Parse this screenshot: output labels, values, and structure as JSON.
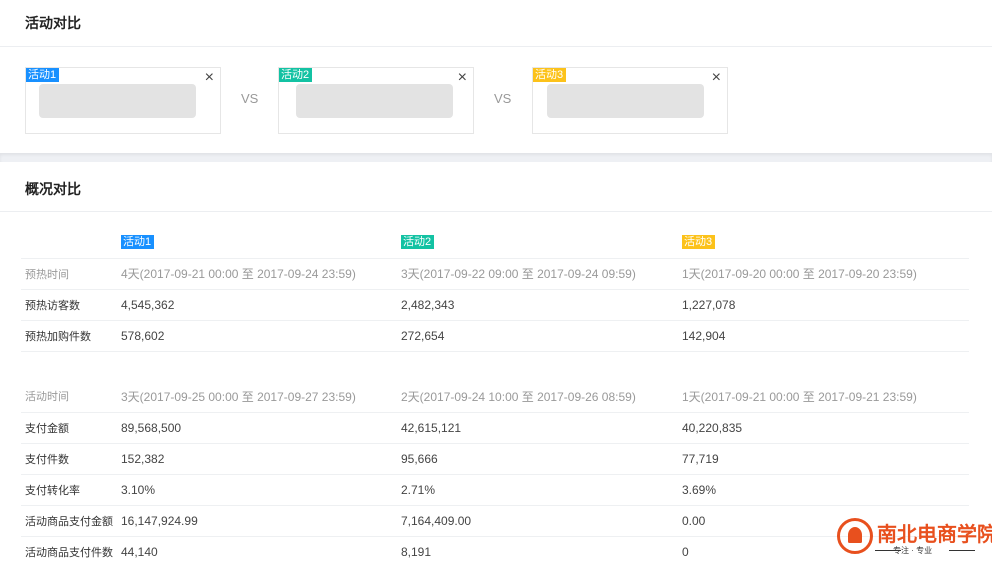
{
  "compare_section": {
    "title": "活动对比",
    "vs_label": "VS",
    "cards": [
      {
        "tag": "活动1",
        "close": "×"
      },
      {
        "tag": "活动2",
        "close": "×"
      },
      {
        "tag": "活动3",
        "close": "×"
      }
    ]
  },
  "overview_section": {
    "title": "概况对比",
    "columns": [
      "活动1",
      "活动2",
      "活动3"
    ],
    "rows": [
      {
        "label": "预热时间",
        "values": [
          "4天(2017-09-21 00:00 至 2017-09-24 23:59)",
          "3天(2017-09-22 09:00 至 2017-09-24 09:59)",
          "1天(2017-09-20 00:00 至 2017-09-20 23:59)"
        ]
      },
      {
        "label": "预热访客数",
        "values": [
          "4,545,362",
          "2,482,343",
          "1,227,078"
        ]
      },
      {
        "label": "预热加购件数",
        "values": [
          "578,602",
          "272,654",
          "142,904"
        ]
      },
      {
        "label": "活动时间",
        "values": [
          "3天(2017-09-25 00:00 至 2017-09-27 23:59)",
          "2天(2017-09-24 10:00 至 2017-09-26 08:59)",
          "1天(2017-09-21 00:00 至 2017-09-21 23:59)"
        ]
      },
      {
        "label": "支付金额",
        "values": [
          "89,568,500",
          "42,615,121",
          "40,220,835"
        ]
      },
      {
        "label": "支付件数",
        "values": [
          "152,382",
          "95,666",
          "77,719"
        ]
      },
      {
        "label": "支付转化率",
        "values": [
          "3.10%",
          "2.71%",
          "3.69%"
        ]
      },
      {
        "label": "活动商品支付金额",
        "values": [
          "16,147,924.99",
          "7,164,409.00",
          "0.00"
        ]
      },
      {
        "label": "活动商品支付件数",
        "values": [
          "44,140",
          "8,191",
          "0"
        ]
      }
    ]
  },
  "watermark": {
    "title": "南北电商学院",
    "subtitle": "专注 · 专业"
  },
  "colors": {
    "activity1": "#1890ff",
    "activity2": "#13c2a3",
    "activity3": "#fcc21a",
    "logo": "#e8501e"
  }
}
